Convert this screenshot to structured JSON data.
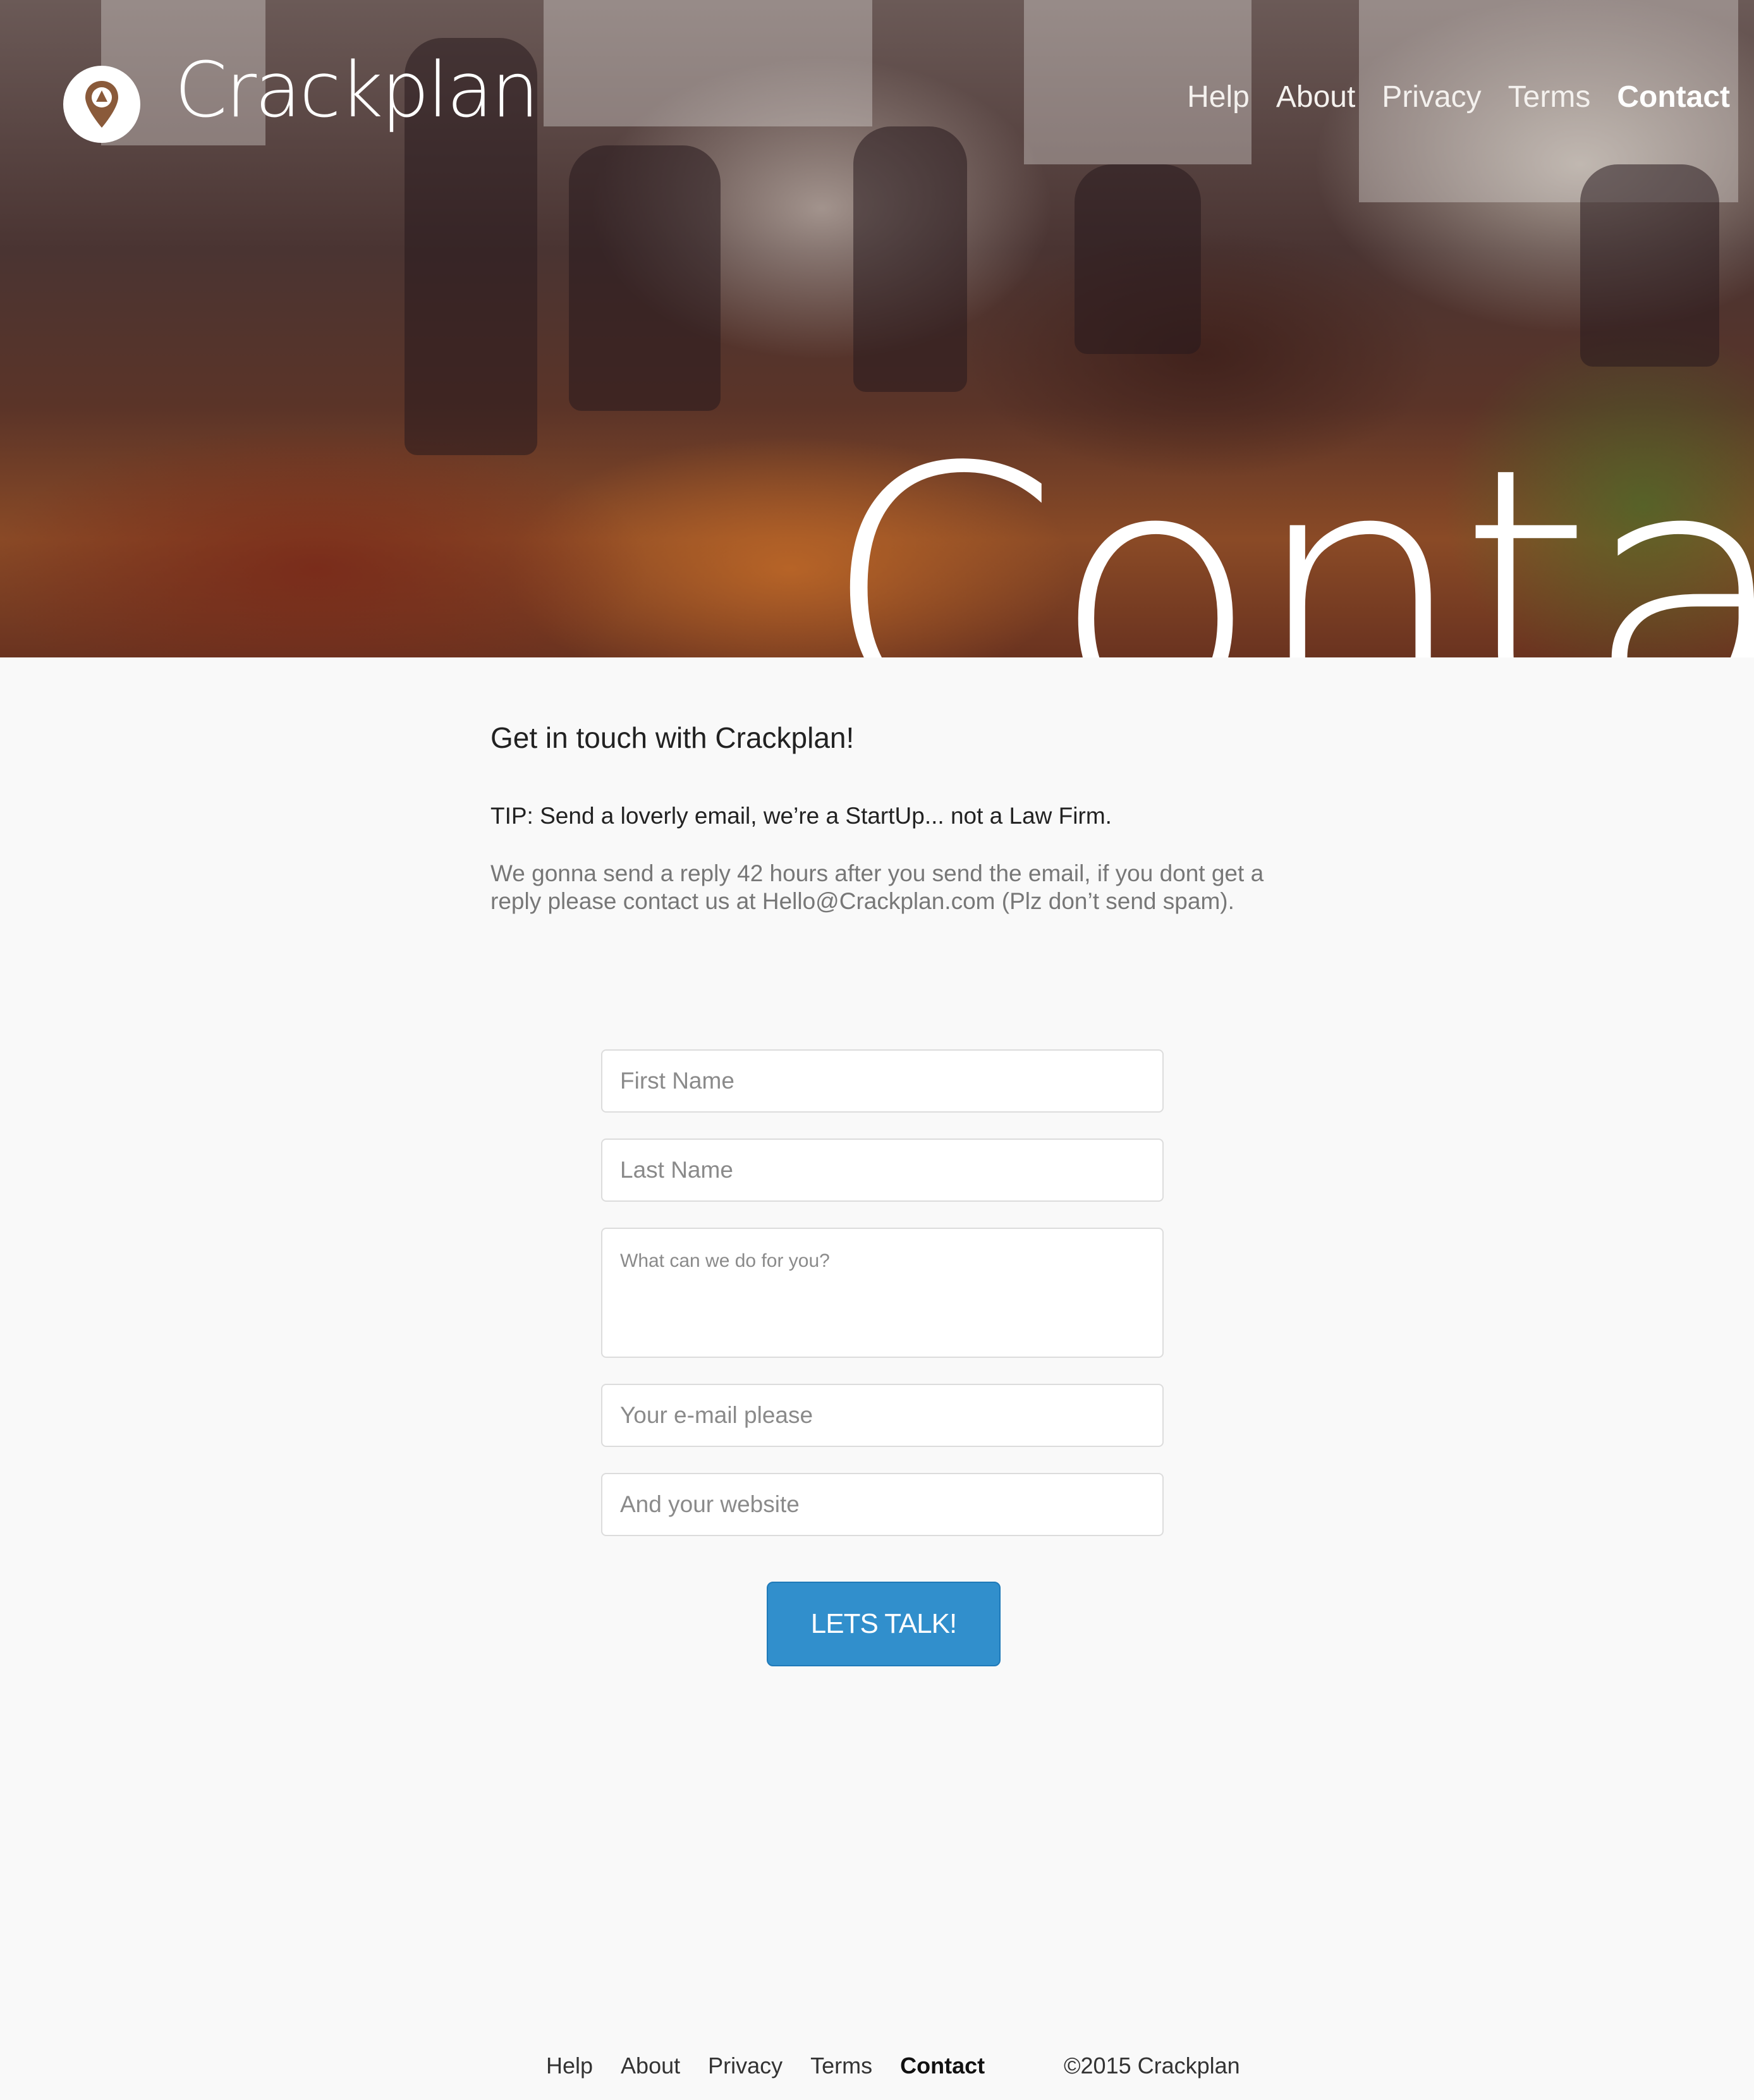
{
  "header": {
    "brand": "Crackplan",
    "logo_icon": "map-pin-icon",
    "nav": [
      {
        "label": "Help",
        "active": false
      },
      {
        "label": "About",
        "active": false
      },
      {
        "label": "Privacy",
        "active": false
      },
      {
        "label": "Terms",
        "active": false
      },
      {
        "label": "Contact",
        "active": true
      }
    ],
    "hero_title": "Contact"
  },
  "intro": {
    "heading": "Get in touch with Crackplan!",
    "tip": "TIP: Send a loverly email, we’re a StartUp... not a Law Firm.",
    "text": "We gonna send a reply 42 hours after you send the email, if you dont get a reply please contact us at Hello@Crackplan.com (Plz don’t send spam)."
  },
  "form": {
    "first_name_placeholder": "First Name",
    "last_name_placeholder": "Last Name",
    "message_placeholder": "What can we do for you?",
    "email_placeholder": "Your e-mail please",
    "website_placeholder": "And your website",
    "submit_label": "LETS TALK!"
  },
  "footer": {
    "nav": [
      {
        "label": "Help",
        "active": false
      },
      {
        "label": "About",
        "active": false
      },
      {
        "label": "Privacy",
        "active": false
      },
      {
        "label": "Terms",
        "active": false
      },
      {
        "label": "Contact",
        "active": true
      }
    ],
    "copyright": "©2015 Crackplan"
  },
  "colors": {
    "accent": "#318fcc",
    "logo_pin": "#8a5a3a",
    "background": "#f9f9f9"
  }
}
